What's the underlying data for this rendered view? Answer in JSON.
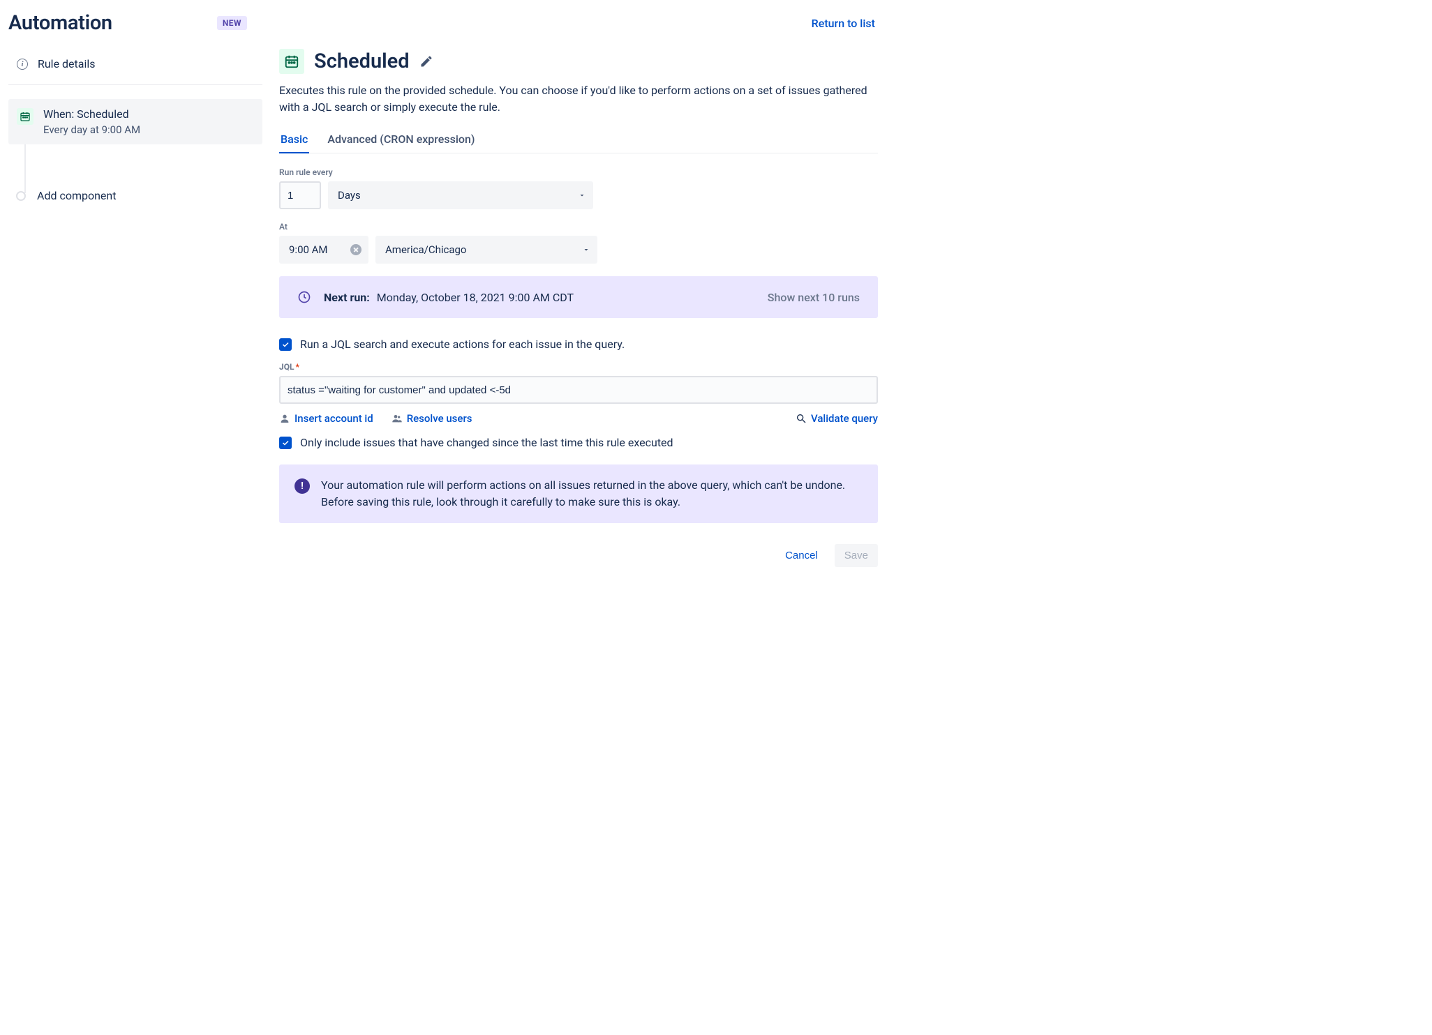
{
  "header": {
    "title": "Automation",
    "badge": "NEW",
    "return_link": "Return to list"
  },
  "sidebar": {
    "rule_details": "Rule details",
    "trigger": {
      "title": "When: Scheduled",
      "subtitle": "Every day at 9:00 AM"
    },
    "add_component": "Add component"
  },
  "main": {
    "title": "Scheduled",
    "description": "Executes this rule on the provided schedule. You can choose if you'd like to perform actions on a set of issues gathered with a JQL search or simply execute the rule.",
    "tabs": {
      "basic": "Basic",
      "advanced": "Advanced (CRON expression)"
    },
    "run_every_label": "Run rule every",
    "run_every_value": "1",
    "unit_select": "Days",
    "at_label": "At",
    "time_value": "9:00 AM",
    "timezone": "America/Chicago",
    "next_run_label": "Next run:",
    "next_run_value": "Monday, October 18, 2021 9:00 AM CDT",
    "show_runs": "Show next 10 runs",
    "jql_checkbox": "Run a JQL search and execute actions for each issue in the query.",
    "jql_label": "JQL",
    "jql_value": "status =\"waiting for customer\" and updated <-5d",
    "links": {
      "insert_account": "Insert account id",
      "resolve_users": "Resolve users",
      "validate": "Validate query"
    },
    "only_changed_checkbox": "Only include issues that have changed since the last time this rule executed",
    "warning": "Your automation rule will perform actions on all issues returned in the above query, which can't be undone. Before saving this rule, look through it carefully to make sure this is okay.",
    "buttons": {
      "cancel": "Cancel",
      "save": "Save"
    }
  }
}
